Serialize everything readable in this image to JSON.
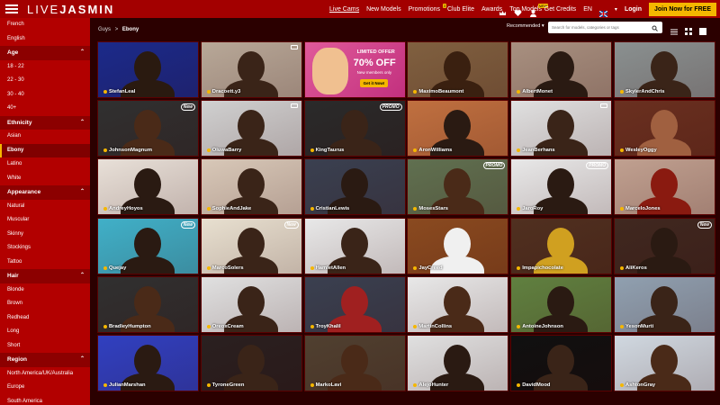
{
  "brand": {
    "logo_a": "LIVE",
    "logo_b": "JASMIN"
  },
  "nav": [
    {
      "label": "Live Cams",
      "active": true,
      "badge": ""
    },
    {
      "label": "New Models",
      "active": false,
      "badge": ""
    },
    {
      "label": "Promotions",
      "active": false,
      "badge": "3"
    },
    {
      "label": "Club Elite",
      "active": false,
      "badge": ""
    },
    {
      "label": "Awards",
      "active": false,
      "badge": ""
    },
    {
      "label": "Top Models",
      "active": false,
      "badge": "NEW"
    }
  ],
  "right_nav": {
    "credits": "Get Credits",
    "lang": "EN",
    "login": "Login",
    "join": "Join Now for FREE"
  },
  "sidebar": [
    {
      "type": "item",
      "label": "French"
    },
    {
      "type": "item",
      "label": "English"
    },
    {
      "type": "head",
      "label": "Age"
    },
    {
      "type": "item",
      "label": "18 - 22"
    },
    {
      "type": "item",
      "label": "22 - 30"
    },
    {
      "type": "item",
      "label": "30 - 40"
    },
    {
      "type": "item",
      "label": "40+"
    },
    {
      "type": "head",
      "label": "Ethnicity"
    },
    {
      "type": "item",
      "label": "Asian"
    },
    {
      "type": "item",
      "label": "Ebony",
      "selected": true
    },
    {
      "type": "item",
      "label": "Latino"
    },
    {
      "type": "item",
      "label": "White"
    },
    {
      "type": "head",
      "label": "Appearance"
    },
    {
      "type": "item",
      "label": "Natural"
    },
    {
      "type": "item",
      "label": "Muscular"
    },
    {
      "type": "item",
      "label": "Skinny"
    },
    {
      "type": "item",
      "label": "Stockings"
    },
    {
      "type": "item",
      "label": "Tattoo"
    },
    {
      "type": "head",
      "label": "Hair"
    },
    {
      "type": "item",
      "label": "Blonde"
    },
    {
      "type": "item",
      "label": "Brown"
    },
    {
      "type": "item",
      "label": "Redhead"
    },
    {
      "type": "item",
      "label": "Long"
    },
    {
      "type": "item",
      "label": "Short"
    },
    {
      "type": "head",
      "label": "Region"
    },
    {
      "type": "item",
      "label": "North America/UK/Australia"
    },
    {
      "type": "item",
      "label": "Europe"
    },
    {
      "type": "item",
      "label": "South America"
    }
  ],
  "breadcrumb": {
    "parent": "Guys",
    "sep": ">",
    "current": "Ebony"
  },
  "sort_label": "Recommended",
  "search": {
    "placeholder": "Search for models, categories or tags"
  },
  "promo": {
    "limited": "LIMITED OFFER",
    "off": "70% OFF",
    "members": "New members only",
    "cta": "Get it Now!"
  },
  "tiles": [
    {
      "name": "StefanLeal",
      "tag": "",
      "bg": "#1b2a8a",
      "fg": "#2a1a10"
    },
    {
      "name": "Dracoett.y3",
      "tag": "cam",
      "bg": "#b8a898",
      "fg": "#3a2418"
    },
    {
      "name": "",
      "tag": "promo",
      "bg": "#d04590",
      "fg": "#f0c090"
    },
    {
      "name": "MaximoBeaumont",
      "tag": "",
      "bg": "#806040",
      "fg": "#3a2010"
    },
    {
      "name": "AlbertMonet",
      "tag": "",
      "bg": "#a89080",
      "fg": "#2a1a12"
    },
    {
      "name": "SkylerAndChris",
      "tag": "",
      "bg": "#8a9090",
      "fg": "#3a2418"
    },
    {
      "name": "JohnsonMagnum",
      "tag": "New",
      "bg": "#303030",
      "fg": "#4a2a18"
    },
    {
      "name": "OluwaBarry",
      "tag": "cam",
      "bg": "#d0d0d0",
      "fg": "#3a2418"
    },
    {
      "name": "KingTaurus",
      "tag": "PROMO",
      "bg": "#2a2a2a",
      "fg": "#3a2418"
    },
    {
      "name": "AronWilliams",
      "tag": "",
      "bg": "#c07040",
      "fg": "#2a1a12"
    },
    {
      "name": "JeanBerhans",
      "tag": "cam",
      "bg": "#e0e0e0",
      "fg": "#3a2418"
    },
    {
      "name": "WesleyOggy",
      "tag": "",
      "bg": "#6a3020",
      "fg": "#a06040"
    },
    {
      "name": "AndreyHoyos",
      "tag": "",
      "bg": "#e8e0d8",
      "fg": "#2a1a12"
    },
    {
      "name": "SophieAndJake",
      "tag": "",
      "bg": "#d8c8b8",
      "fg": "#3a2418"
    },
    {
      "name": "CristianLewis",
      "tag": "",
      "bg": "#3a4050",
      "fg": "#2a1a12"
    },
    {
      "name": "MosesStars",
      "tag": "PROMO",
      "bg": "#607050",
      "fg": "#4a2a18"
    },
    {
      "name": "JaroRoy",
      "tag": "PROMO",
      "bg": "#e8e8e8",
      "fg": "#2a1a12"
    },
    {
      "name": "MarceloJones",
      "tag": "",
      "bg": "#c0a090",
      "fg": "#8a1a10"
    },
    {
      "name": "Quejay",
      "tag": "New",
      "bg": "#40b0c8",
      "fg": "#2a1a12"
    },
    {
      "name": "MarcoSolers",
      "tag": "New",
      "bg": "#e8e0d0",
      "fg": "#3a2418"
    },
    {
      "name": "HamletAllen",
      "tag": "",
      "bg": "#e8e8e8",
      "fg": "#3a2418"
    },
    {
      "name": "JayCreed",
      "tag": "",
      "bg": "#8a4a20",
      "fg": "#f0f0f0"
    },
    {
      "name": "Impapichocolate",
      "tag": "",
      "bg": "#503020",
      "fg": "#d0a020"
    },
    {
      "name": "AliKeros",
      "tag": "New",
      "bg": "#402820",
      "fg": "#2a1a12"
    },
    {
      "name": "BradleyHumpton",
      "tag": "",
      "bg": "#303030",
      "fg": "#4a2a18"
    },
    {
      "name": "OreoxCream",
      "tag": "",
      "bg": "#e0e0e0",
      "fg": "#3a2418"
    },
    {
      "name": "TroyKhalil",
      "tag": "",
      "bg": "#3a4050",
      "fg": "#a02020"
    },
    {
      "name": "MartinCollins",
      "tag": "",
      "bg": "#e8e8e8",
      "fg": "#4a2a18"
    },
    {
      "name": "AntoineJohnson",
      "tag": "",
      "bg": "#608040",
      "fg": "#2a1a12"
    },
    {
      "name": "YesonMurti",
      "tag": "",
      "bg": "#90a0b0",
      "fg": "#3a2418"
    },
    {
      "name": "JulianMarshan",
      "tag": "",
      "bg": "#3040c0",
      "fg": "#2a1a12"
    },
    {
      "name": "TyroneGreen",
      "tag": "",
      "bg": "#2a2020",
      "fg": "#3a2418"
    },
    {
      "name": "MarkoLavi",
      "tag": "",
      "bg": "#504030",
      "fg": "#4a2a18"
    },
    {
      "name": "AlejoHunter",
      "tag": "",
      "bg": "#e0e0e0",
      "fg": "#2a1a12"
    },
    {
      "name": "DavidMood",
      "tag": "",
      "bg": "#101010",
      "fg": "#3a2418"
    },
    {
      "name": "AshtonGray",
      "tag": "",
      "bg": "#d0d8e0",
      "fg": "#4a2a18"
    }
  ]
}
